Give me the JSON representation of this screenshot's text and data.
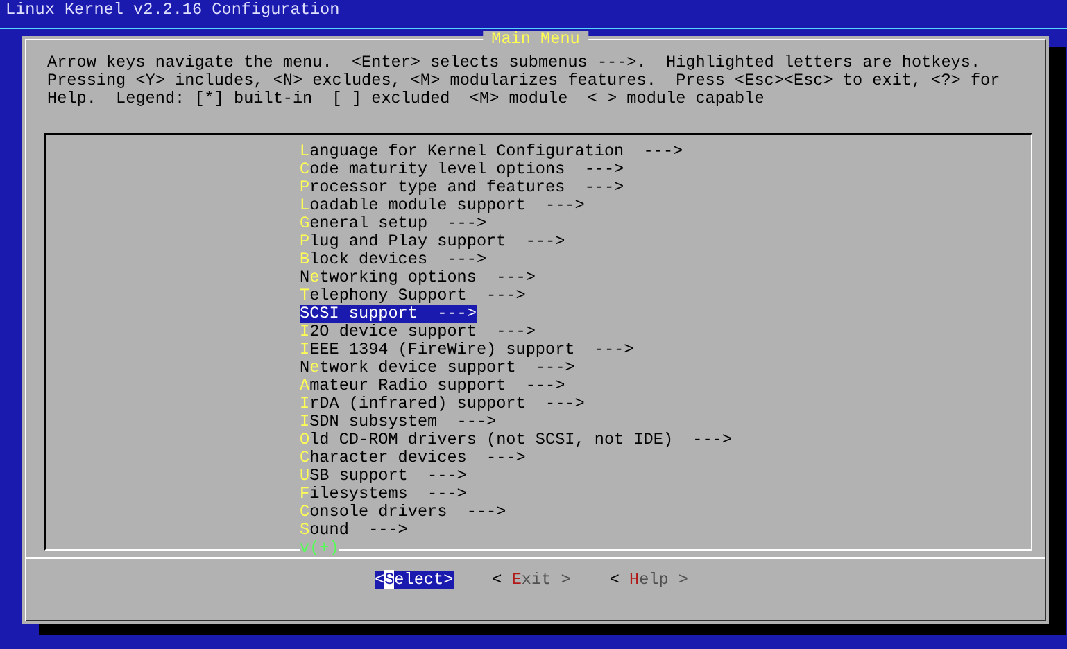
{
  "window": {
    "title": "Linux Kernel v2.2.16 Configuration"
  },
  "dialog": {
    "title": "Main Menu",
    "help_lines": [
      "Arrow keys navigate the menu.  <Enter> selects submenus --->.  Highlighted letters are hotkeys.",
      "Pressing <Y> includes, <N> excludes, <M> modularizes features.  Press <Esc><Esc> to exit, <?> for",
      "Help.  Legend: [*] built-in  [ ] excluded  <M> module  < > module capable"
    ],
    "menu_items": [
      {
        "hotkey": "L",
        "after": "anguage for Kernel Configuration  --->",
        "selected": false
      },
      {
        "hotkey": "C",
        "after": "ode maturity level options  --->",
        "selected": false
      },
      {
        "hotkey": "P",
        "after": "rocessor type and features  --->",
        "selected": false
      },
      {
        "hotkey": "L",
        "after": "oadable module support  --->",
        "selected": false
      },
      {
        "hotkey": "G",
        "after": "eneral setup  --->",
        "selected": false
      },
      {
        "hotkey": "P",
        "after": "lug and Play support  --->",
        "selected": false
      },
      {
        "hotkey": "B",
        "after": "lock devices  --->",
        "selected": false
      },
      {
        "before": "N",
        "hotkey": "e",
        "after": "tworking options  --->",
        "selected": false
      },
      {
        "hotkey": "T",
        "after": "elephony Support  --->",
        "selected": false
      },
      {
        "hotkey": "S",
        "after": "CSI support  --->",
        "selected": true
      },
      {
        "hotkey": "I",
        "after": "2O device support  --->",
        "selected": false
      },
      {
        "hotkey": "I",
        "after": "EEE 1394 (FireWire) support  --->",
        "selected": false
      },
      {
        "before": "N",
        "hotkey": "e",
        "after": "twork device support  --->",
        "selected": false
      },
      {
        "hotkey": "A",
        "after": "mateur Radio support  --->",
        "selected": false
      },
      {
        "hotkey": "I",
        "after": "rDA (infrared) support  --->",
        "selected": false
      },
      {
        "hotkey": "I",
        "after": "SDN subsystem  --->",
        "selected": false
      },
      {
        "hotkey": "O",
        "after": "ld CD-ROM drivers (not SCSI, not IDE)  --->",
        "selected": false
      },
      {
        "hotkey": "C",
        "after": "haracter devices  --->",
        "selected": false
      },
      {
        "hotkey": "U",
        "after": "SB support  --->",
        "selected": false
      },
      {
        "hotkey": "F",
        "after": "ilesystems  --->",
        "selected": false
      },
      {
        "hotkey": "C",
        "after": "onsole drivers  --->",
        "selected": false
      },
      {
        "hotkey": "S",
        "after": "ound  --->",
        "selected": false
      }
    ],
    "more_indicator": "v(+)",
    "buttons": [
      {
        "before": "<",
        "hotkey": "S",
        "after": "elect>",
        "selected": true
      },
      {
        "before": "< ",
        "hotkey": "E",
        "after": "xit >",
        "selected": false
      },
      {
        "before": "< ",
        "hotkey": "H",
        "after": "elp >",
        "selected": false
      }
    ]
  }
}
